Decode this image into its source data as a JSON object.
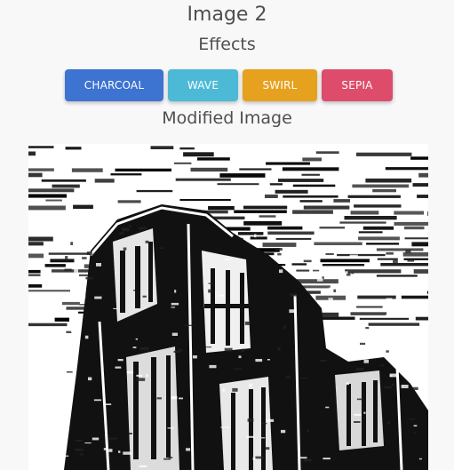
{
  "header": {
    "title": "Image 2",
    "effects_label": "Effects"
  },
  "effects": {
    "charcoal_label": "CHARCOAL",
    "wave_label": "WAVE",
    "swirl_label": "SWIRL",
    "sepia_label": "SEPIA"
  },
  "result": {
    "label": "Modified Image"
  },
  "colors": {
    "charcoal": "#3d73d1",
    "wave": "#4cb9d6",
    "swirl": "#e6a11e",
    "sepia": "#de4c6b"
  }
}
